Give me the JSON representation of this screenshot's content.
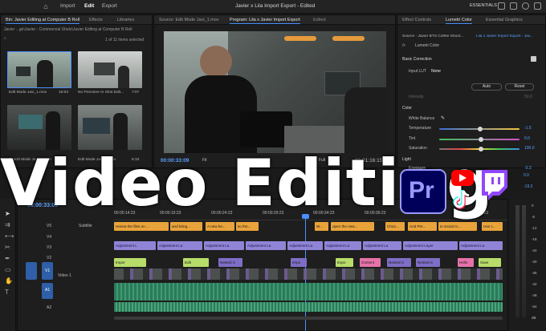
{
  "topbar": {
    "nav": [
      "Import",
      "Edit",
      "Export"
    ],
    "active_nav": "Edit",
    "title": "Javier x Lila Import Export - Edited",
    "workspace": "ESSENTIALS"
  },
  "project_panel": {
    "tabs": [
      "Bin: Javier Editing at Computer B Roll",
      "Effects",
      "Libraries"
    ],
    "path": "Javier ...ge\\Javier - Commercial Shots\\Javier Editing at Computer B Roll",
    "selection": "1 of 11 items selected",
    "items": [
      {
        "name": "Edit Mode Javi_1.mov",
        "duration": "16:03"
      },
      {
        "name": "No Premiere In Shot Edit...",
        "duration": "7:07"
      },
      {
        "name": "Export Mode Javi_2.mov",
        "duration": "6:02"
      },
      {
        "name": "Edit Mode Javi_6.mov",
        "duration": "8:10"
      }
    ]
  },
  "program_panel": {
    "tabs": [
      "Source: Edit Mode Javi_1.mov",
      "Program: Lila x Javier Import Export",
      "Edited"
    ],
    "timecode": "00:00:33:09",
    "fit": "Fit",
    "quality": "Full",
    "duration": "00:01:16:15"
  },
  "lumetri_panel": {
    "tabs": [
      "Effect Controls",
      "Lumetri Color",
      "Essential Graphics"
    ],
    "source": "Source - Javier BTS Coffee Shoot...",
    "sequence": "Lila x Javier Import Export - Jav...",
    "fx": "Lumetri Color",
    "basic_correction": "Basic Correction",
    "input_lut_label": "Input LUT",
    "input_lut_value": "None",
    "auto": "Auto",
    "reset": "Reset",
    "intensity_label": "Intensity",
    "intensity_value": "50.0",
    "color_section": "Color",
    "white_balance": "White Balance",
    "temperature_label": "Temperature",
    "temperature_value": "-1.5",
    "tint_label": "Tint",
    "tint_value": "0.0",
    "saturation_label": "Saturation",
    "saturation_value": "100.0",
    "light_section": "Light",
    "exposure_label": "Exposure",
    "exposure_value": "-0.3",
    "extra_values": [
      "0.0",
      "-19.2"
    ]
  },
  "timeline": {
    "timecode": "00:00:33:09",
    "ruler": [
      "00:00:14:23",
      "00:00:19:23",
      "00:00:24:23",
      "00:00:29:23",
      "00:00:34:23",
      "00:00:39:23",
      "00:00:44:23",
      "00:00:49:22"
    ],
    "tracks": [
      "V5",
      "V4",
      "V3",
      "V2",
      "V1",
      "A1",
      "A2"
    ],
    "v5_name": "Subtitle",
    "v1_name": "Video 1",
    "subtitles": [
      "review the files on ...",
      "and bring...",
      "A new he...",
      "so the...",
      "W...",
      "open the new...",
      "Choo...",
      "And Pre...",
      "to social m...",
      "Use t..."
    ],
    "adjust_label": "Adjustment La",
    "adjust_labels": [
      "Adjustment L",
      "Adjustment La",
      "Adjustment La",
      "Adjustment La",
      "Adjustment La",
      "Adjustment La",
      "Adjustment La",
      "Adjustment Layer",
      "Adjustment La"
    ],
    "video_clips": [
      "Impor",
      "Edit",
      "Nested S",
      "Impo",
      "Expo",
      "Content",
      "Nested S",
      "Nested S",
      "Hello",
      "Save"
    ],
    "meter_scale": [
      "0",
      "-6",
      "-12",
      "-18",
      "-24",
      "-30",
      "-36",
      "-42",
      "-48",
      "-54",
      "dB"
    ]
  },
  "overlay": {
    "headline": "Video Editing",
    "logos": {
      "premiere": "Pr"
    }
  },
  "colors": {
    "accent": "#4a90ff",
    "subtitle": "#e8a33a",
    "adjustment": "#8f84d6",
    "video": "#7e6ec5",
    "audio": "#2c7a5a",
    "premiere_bg": "#00005b",
    "premiere_fg": "#9999ff",
    "youtube": "#ff0000",
    "twitch": "#9146ff"
  }
}
